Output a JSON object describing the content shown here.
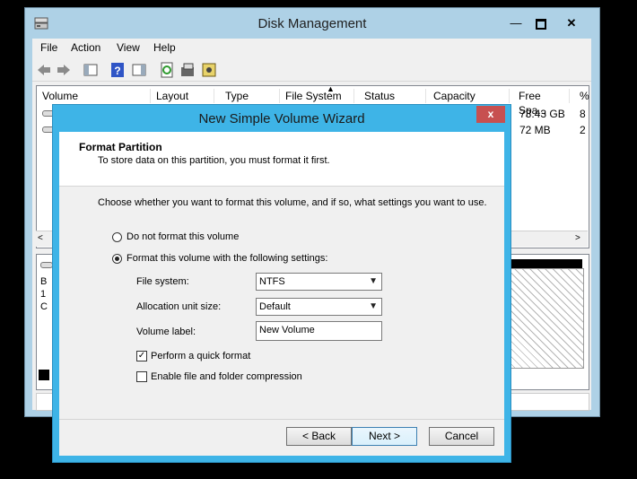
{
  "disk_mgmt": {
    "title": "Disk Management",
    "menu": [
      "File",
      "Action",
      "View",
      "Help"
    ],
    "columns": [
      "Volume",
      "Layout",
      "Type",
      "File System",
      "Status",
      "Capacity",
      "Free Spa...",
      "%"
    ],
    "rows": [
      {
        "free": "73.43 GB",
        "pct": "8"
      },
      {
        "free": "72 MB",
        "pct": "2"
      }
    ],
    "graph_labels": [
      "B",
      "1",
      "C"
    ]
  },
  "wizard": {
    "title": "New Simple Volume Wizard",
    "close_label": "x",
    "header_title": "Format Partition",
    "header_subtitle": "To store data on this partition, you must format it first.",
    "instruction": "Choose whether you want to format this volume, and if so, what settings you want to use.",
    "radio_no_format": "Do not format this volume",
    "radio_format": "Format this volume with the following settings:",
    "file_system_label": "File system:",
    "file_system_value": "NTFS",
    "alloc_label": "Allocation unit size:",
    "alloc_value": "Default",
    "volume_label_label": "Volume label:",
    "volume_label_value": "New Volume",
    "quick_format_label": "Perform a quick format",
    "compression_label": "Enable file and folder compression",
    "back_button": "< Back",
    "next_button": "Next >",
    "cancel_button": "Cancel"
  }
}
